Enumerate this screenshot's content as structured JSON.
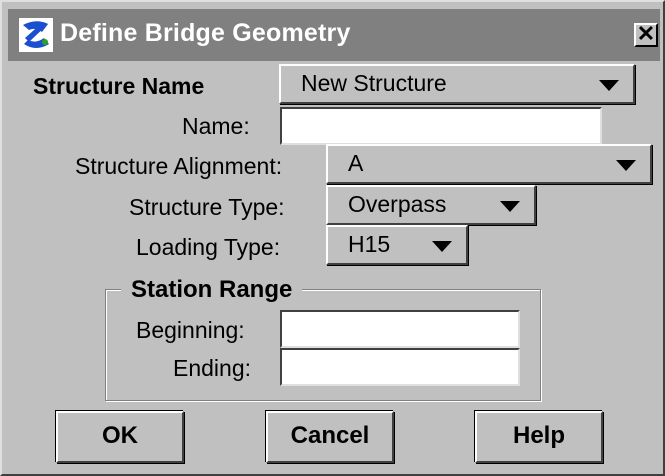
{
  "window": {
    "title": "Define Bridge Geometry",
    "close_glyph": "✕"
  },
  "form": {
    "structure_name": {
      "label": "Structure Name",
      "value": "New Structure"
    },
    "name": {
      "label": "Name:",
      "value": ""
    },
    "structure_alignment": {
      "label": "Structure Alignment:",
      "value": "A"
    },
    "structure_type": {
      "label": "Structure Type:",
      "value": "Overpass"
    },
    "loading_type": {
      "label": "Loading Type:",
      "value": "H15"
    }
  },
  "station_range": {
    "title": "Station Range",
    "beginning": {
      "label": "Beginning:",
      "value": ""
    },
    "ending": {
      "label": "Ending:",
      "value": ""
    }
  },
  "buttons": {
    "ok": "OK",
    "cancel": "Cancel",
    "help": "Help"
  },
  "icons": {
    "app": "app-logo-icon",
    "close": "close-icon",
    "dropdown": "triangle-down-icon"
  },
  "colors": {
    "titlebar": "#808080",
    "face": "#c0c0c0",
    "field": "#ffffff"
  }
}
